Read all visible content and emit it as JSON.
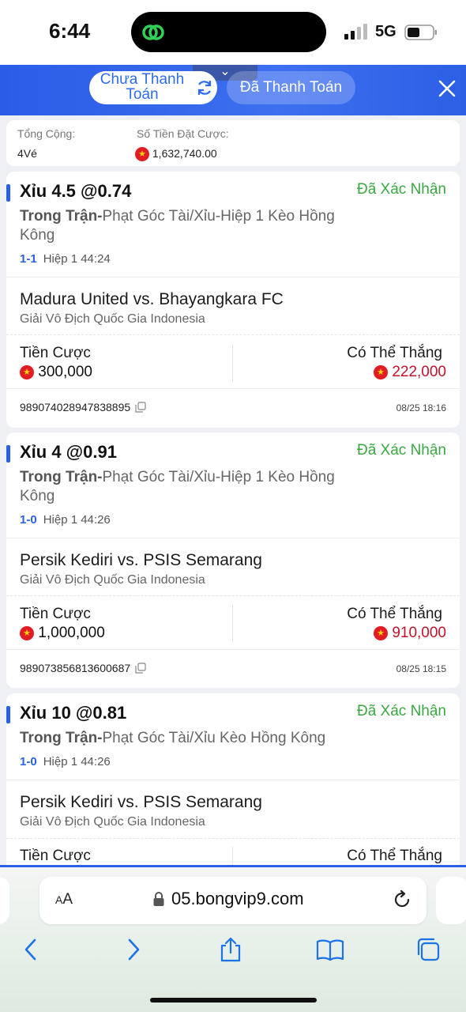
{
  "status_bar": {
    "time": "6:44",
    "network": "5G"
  },
  "header": {
    "tab_unpaid": "Chưa Thanh Toán",
    "tab_paid": "Đã Thanh Toán",
    "pull_glyph": "⌄"
  },
  "summary": {
    "total_label": "Tổng Cộng:",
    "total_value": "4Vé",
    "stake_label": "Số Tiền Đặt Cược:",
    "stake_value": "1,632,740.00"
  },
  "bets": [
    {
      "title": "Xỉu 4.5 @0.74",
      "status": "Đã Xác Nhận",
      "market_prefix": "Trong Trận-",
      "market": "Phạt Góc Tài/Xỉu-Hiệp 1 Kèo Hồng Kông",
      "score": "1-1",
      "period": "Hiệp 1 44:24",
      "match": "Madura United vs. Bhayangkara FC",
      "league": "Giải Vô Địch Quốc Gia Indonesia",
      "stake_label": "Tiền Cược",
      "stake": "300,000",
      "win_label": "Có Thể Thắng",
      "win": "222,000",
      "ticket": "989074028947838895",
      "time": "08/25 18:16"
    },
    {
      "title": "Xỉu 4 @0.91",
      "status": "Đã Xác Nhận",
      "market_prefix": "Trong Trận-",
      "market": "Phạt Góc Tài/Xỉu-Hiệp 1 Kèo Hồng Kông",
      "score": "1-0",
      "period": "Hiệp 1 44:26",
      "match": "Persik Kediri vs. PSIS Semarang",
      "league": "Giải Vô Địch Quốc Gia Indonesia",
      "stake_label": "Tiền Cược",
      "stake": "1,000,000",
      "win_label": "Có Thể Thắng",
      "win": "910,000",
      "ticket": "989073856813600687",
      "time": "08/25 18:15"
    },
    {
      "title": "Xỉu 10 @0.81",
      "status": "Đã Xác Nhận",
      "market_prefix": "Trong Trận-",
      "market": "Phạt Góc Tài/Xỉu Kèo Hồng Kông",
      "score": "1-0",
      "period": "Hiệp 1 44:26",
      "match": "Persik Kediri vs. PSIS Semarang",
      "league": "Giải Vô Địch Quốc Gia Indonesia",
      "stake_label": "Tiền Cược",
      "win_label": "Có Thể Thắng"
    }
  ],
  "browser": {
    "url": "05.bongvip9.com",
    "aa_big": "A",
    "aa_small": "A"
  },
  "colors": {
    "brand_blue": "#2b5fe6",
    "confirmed_green": "#3aa843",
    "win_red": "#c0132b"
  }
}
